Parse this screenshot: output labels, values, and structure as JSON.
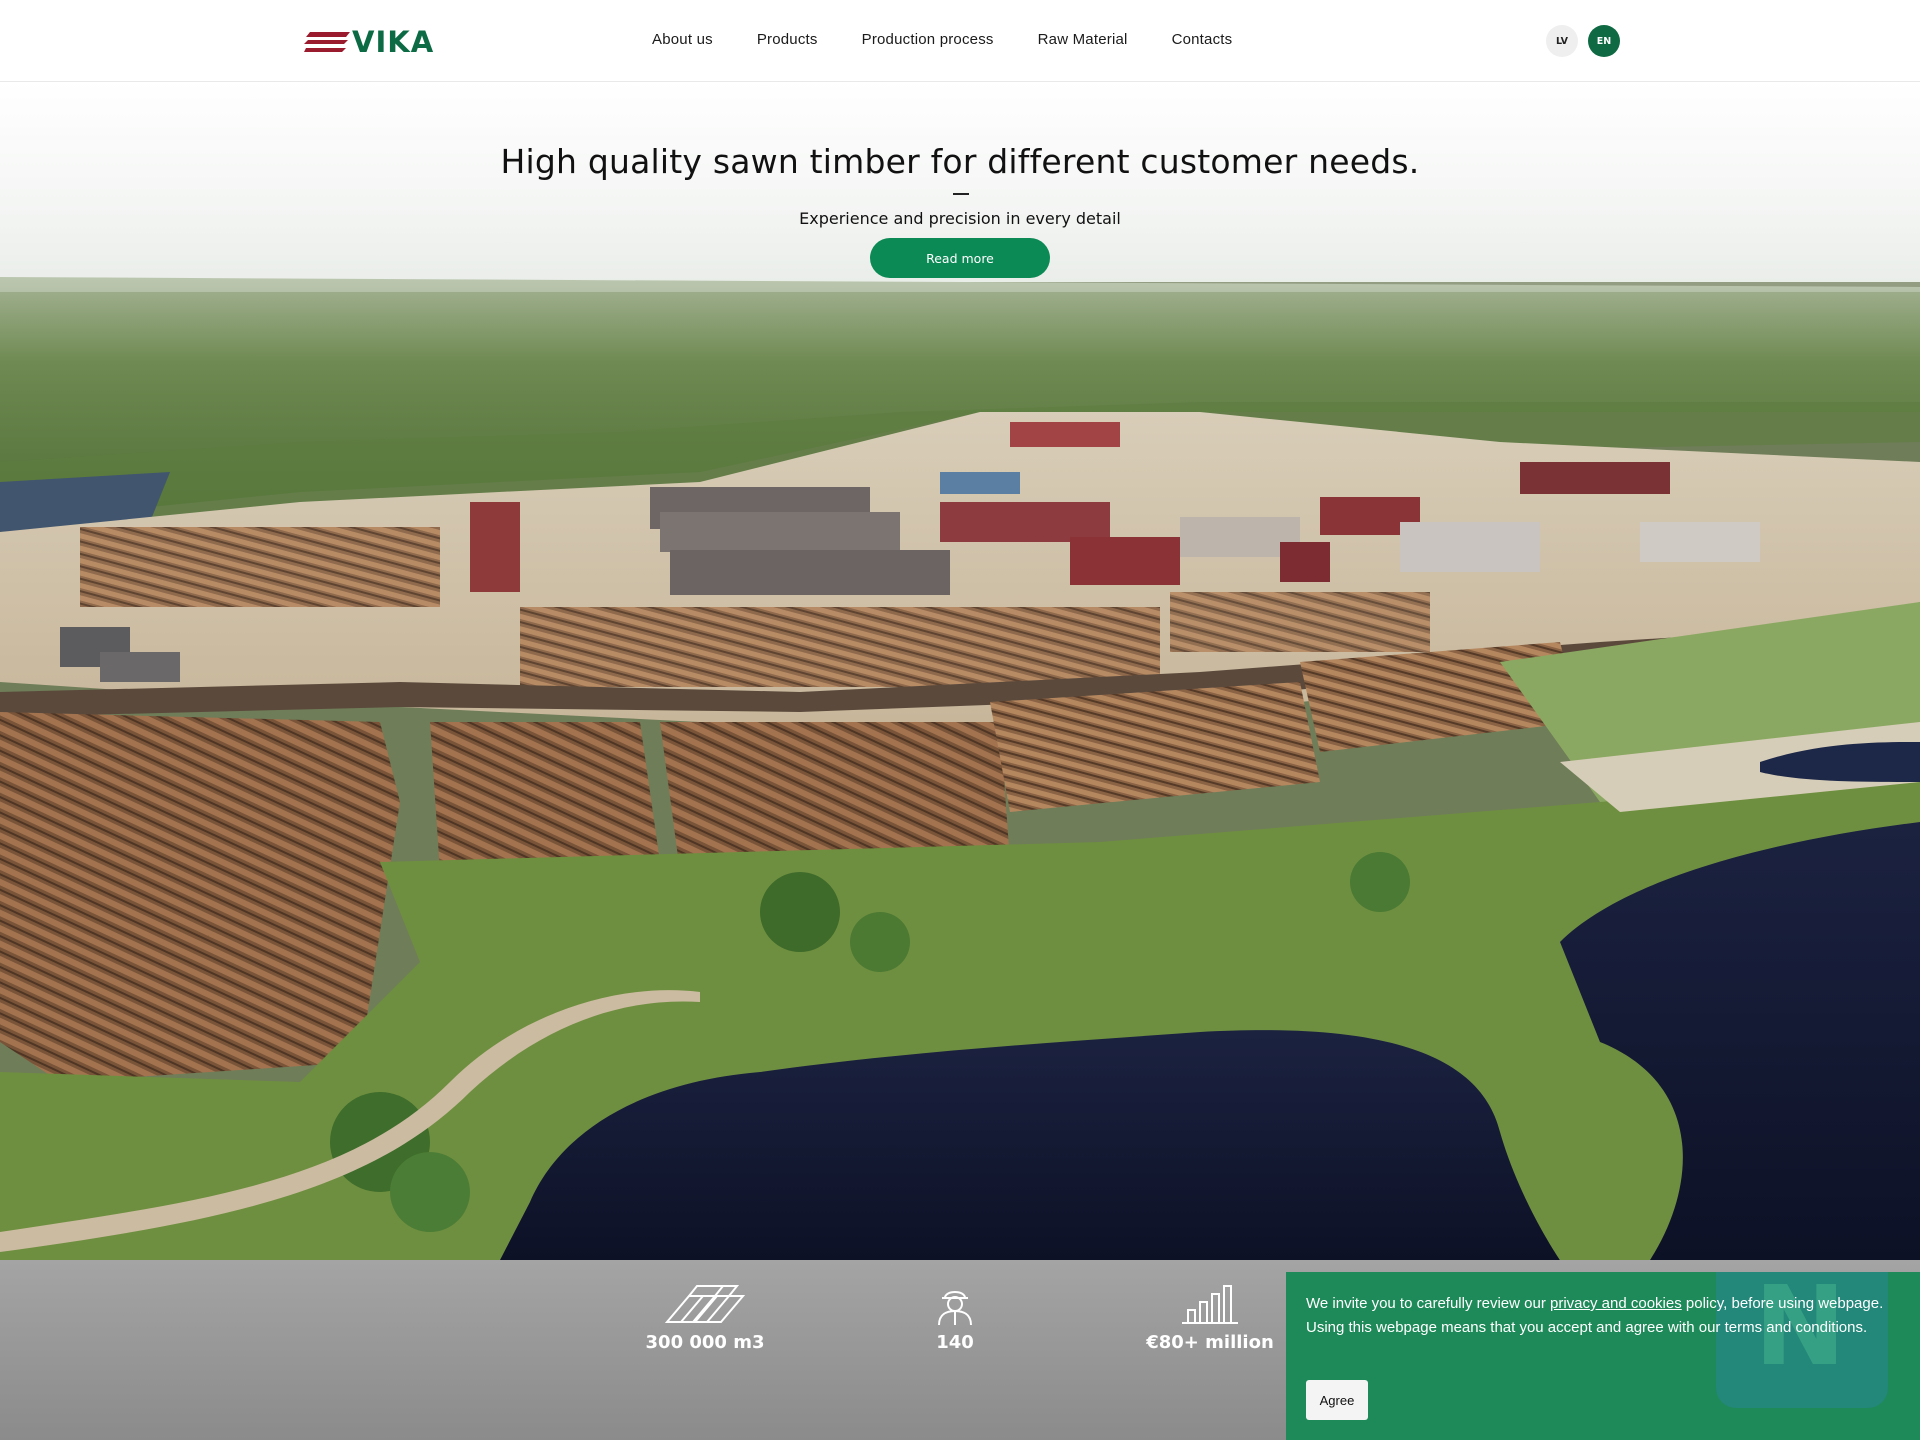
{
  "brand": {
    "logo_text": "VIKA",
    "logo_colors": {
      "stripes": "#9b1b2e",
      "text": "#0c6b44"
    }
  },
  "nav": {
    "items": [
      "About us",
      "Products",
      "Production process",
      "Raw Material",
      "Contacts"
    ]
  },
  "languages": {
    "lv": "LV",
    "en": "EN",
    "active": "EN"
  },
  "hero": {
    "title": "High quality sawn timber for different customer needs.",
    "subtitle": "Experience and precision in every detail",
    "cta_label": "Read more",
    "image_description_icon": "aerial-sawmill-photo"
  },
  "stats": [
    {
      "icon": "timber-planks-icon",
      "value": "300 000 m3"
    },
    {
      "icon": "worker-helmet-icon",
      "value": "140"
    },
    {
      "icon": "bar-chart-icon",
      "value": "€80+ million"
    }
  ],
  "cookie": {
    "text_before": "We invite you to carefully review our ",
    "link_text": "privacy and cookies",
    "text_after": " policy, before using webpage. Using this webpage means that you accept and agree with our terms and conditions.",
    "agree_label": "Agree"
  },
  "colors": {
    "accent": "#0c8a55",
    "cookie_bg": "#1f8a59",
    "stats_bg": "#9a9a9a"
  }
}
